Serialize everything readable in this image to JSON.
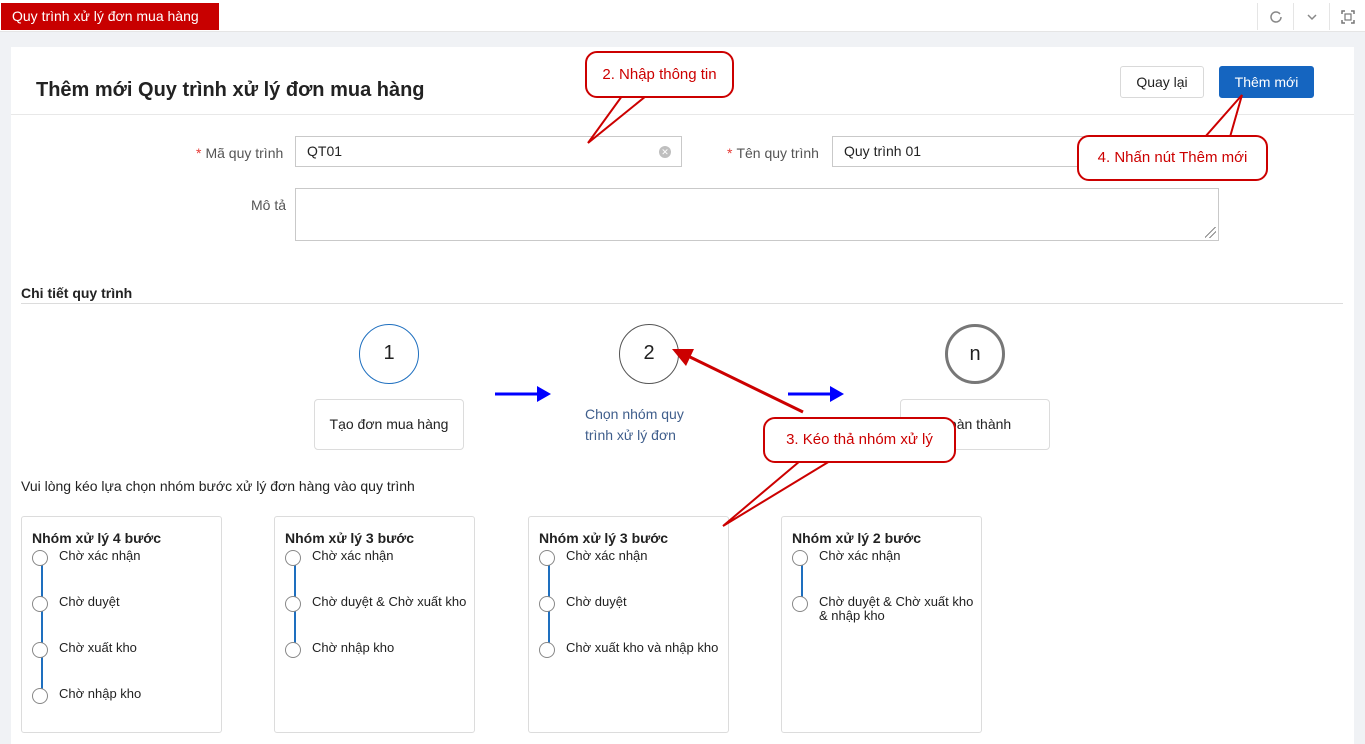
{
  "tab": {
    "label": "Quy trình xử lý đơn mua hàng"
  },
  "top_icons": [
    "refresh-icon",
    "chevron-down-icon",
    "fullscreen-icon"
  ],
  "header": {
    "title": "Thêm mới Quy trình xử lý đơn mua hàng",
    "back_label": "Quay lại",
    "add_label": "Thêm mới"
  },
  "form": {
    "code_label": "Mã quy trình",
    "code_value": "QT01",
    "name_label": "Tên quy trình",
    "name_value": "Quy trình 01",
    "desc_label": "Mô tả",
    "desc_value": "",
    "required_mark": "*"
  },
  "detail": {
    "title": "Chi tiết quy trình",
    "steps": [
      {
        "number": "1",
        "label": "Tạo đơn mua hàng"
      },
      {
        "number": "2",
        "label": "Chọn nhóm quy trình xử lý đơn"
      },
      {
        "number": "n",
        "label": "Hoàn thành"
      }
    ],
    "instruction": "Vui lòng kéo lựa chọn nhóm bước xử lý đơn hàng vào quy trình"
  },
  "groups": [
    {
      "title": "Nhóm xử lý 4 bước",
      "steps": [
        "Chờ xác nhận",
        "Chờ duyệt",
        "Chờ xuất kho",
        "Chờ nhập kho"
      ]
    },
    {
      "title": "Nhóm xử lý 3 bước",
      "steps": [
        "Chờ xác nhận",
        "Chờ duyệt & Chờ xuất kho",
        "Chờ nhập kho"
      ]
    },
    {
      "title": "Nhóm xử lý 3 bước",
      "steps": [
        "Chờ xác nhận",
        "Chờ duyệt",
        "Chờ xuất kho và nhập kho"
      ]
    },
    {
      "title": "Nhóm xử lý 2 bước",
      "steps": [
        "Chờ xác nhận",
        "Chờ duyệt & Chờ xuất kho & nhập kho"
      ]
    }
  ],
  "annotations": {
    "note_2": "2. Nhập thông tin",
    "note_3": "3. Kéo thả nhóm xử lý",
    "note_4": "4. Nhấn nút Thêm mới"
  },
  "colors": {
    "tab_red": "#c80000",
    "primary_blue": "#1565c0",
    "annotation_red": "#c00000",
    "arrow_blue": "#0000ff",
    "timeline_blue": "#1e6fbf"
  }
}
